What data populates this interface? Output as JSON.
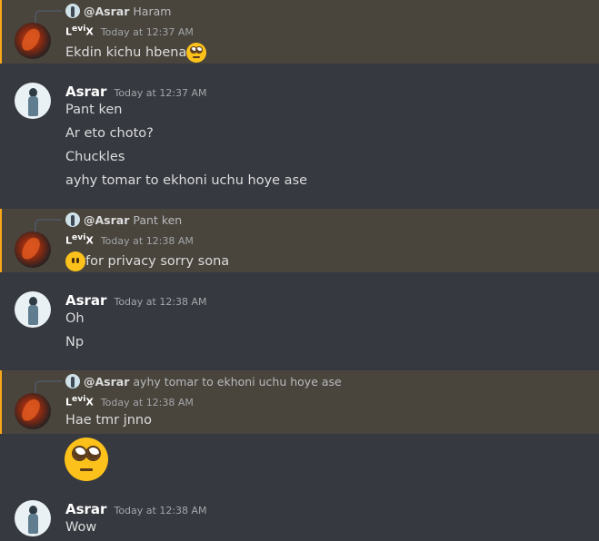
{
  "colors": {
    "background": "#36393f",
    "mention_highlight": "#49443c",
    "mention_bar": "#faa81a"
  },
  "messages": [
    {
      "reply": {
        "name": "@Asrar",
        "text": "Haram"
      },
      "author": "Levi",
      "time": "Today at 12:37 AM",
      "lines": [
        {
          "text": "Ekdin kichu hbena",
          "emoji": "face-with-rolling-eyes"
        }
      ]
    },
    {
      "author": "Asrar",
      "time": "Today at 12:37 AM",
      "lines": [
        {
          "text": "Pant ken"
        },
        {
          "text": "Ar eto choto?"
        },
        {
          "text": "Chuckles"
        },
        {
          "text": "ayhy tomar to ekhoni uchu hoye ase"
        }
      ]
    },
    {
      "reply": {
        "name": "@Asrar",
        "text": "Pant ken"
      },
      "author": "Levi",
      "time": "Today at 12:38 AM",
      "lines": [
        {
          "emoji_before": "face-without-mouth",
          "text": "for privacy sorry sona"
        }
      ]
    },
    {
      "author": "Asrar",
      "time": "Today at 12:38 AM",
      "lines": [
        {
          "text": "Oh"
        },
        {
          "text": "Np"
        }
      ]
    },
    {
      "reply": {
        "name": "@Asrar",
        "text": "ayhy tomar to ekhoni uchu hoye ase"
      },
      "author": "Levi",
      "time": "Today at 12:38 AM",
      "lines": [
        {
          "text": "Hae tmr jnno"
        },
        {
          "emoji": "face-with-rolling-eyes-large"
        }
      ]
    },
    {
      "author": "Asrar",
      "time": "Today at 12:38 AM",
      "lines": [
        {
          "text": "Wow"
        }
      ]
    }
  ]
}
